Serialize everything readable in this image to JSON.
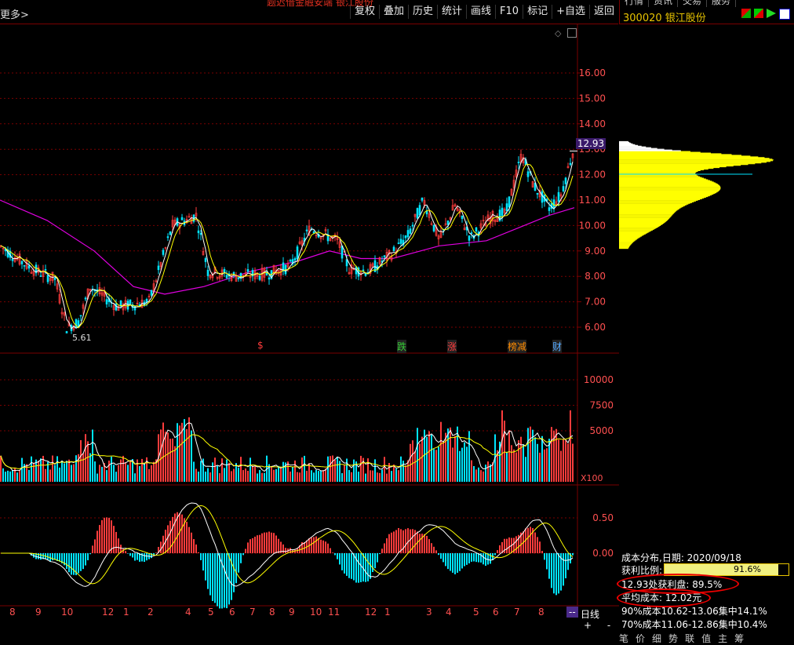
{
  "toolbar": {
    "left_label": "更多>",
    "banner": "题迟借金融安端 银江股份",
    "buttons": [
      "复权",
      "叠加",
      "历史",
      "统计",
      "画线",
      "F10",
      "标记",
      "+自选",
      "返回"
    ]
  },
  "right_panel": {
    "tabs": [
      "行情",
      "资讯",
      "交易",
      "服务"
    ],
    "stock_code_name": "300020 银江股份"
  },
  "price_axis": [
    "16.00",
    "15.00",
    "14.00",
    "13.00",
    "12.00",
    "11.00",
    "10.00",
    "9.00",
    "8.00",
    "7.00",
    "6.00"
  ],
  "current_price": "12.93",
  "low_marker": "5.61",
  "event_markers": [
    "$",
    "跌",
    "涨",
    "榜减",
    "财"
  ],
  "volume_axis": [
    "10000",
    "7500",
    "5000"
  ],
  "volume_unit": "X100",
  "macd_axis": [
    "0.50",
    "0.00"
  ],
  "month_ticks": [
    "8",
    "9",
    "10",
    "12",
    "1",
    "2",
    "4",
    "5",
    "6",
    "7",
    "8",
    "9",
    "10",
    "11",
    "12",
    "1",
    "3",
    "4",
    "5",
    "6",
    "7",
    "8",
    "--"
  ],
  "period_label": "日线",
  "zoom": {
    "plus": "+",
    "minus": "-"
  },
  "cost_panel": {
    "date_line": "成本分布,日期: 2020/09/18",
    "profit_label": "获利比例:",
    "profit_value": "91.6%",
    "profit_ratio": 0.916,
    "profit_at_price": "12.93处获利盘: 89.5%",
    "avg_cost": "平均成本: 12.02元",
    "cost90": "90%成本10.62-13.06集中14.1%",
    "cost70": "70%成本11.06-12.86集中10.4%"
  },
  "bottom_tabs": [
    "笔",
    "价",
    "细",
    "势",
    "联",
    "值",
    "主",
    "筹"
  ],
  "colors": {
    "up": "#ff3c3c",
    "down": "#00e5ff",
    "ma_white": "#ffffff",
    "ma_yellow": "#ffff00",
    "ma_purple": "#e000e0",
    "grid": "#7a0000",
    "axis_text": "#ff5050"
  }
}
